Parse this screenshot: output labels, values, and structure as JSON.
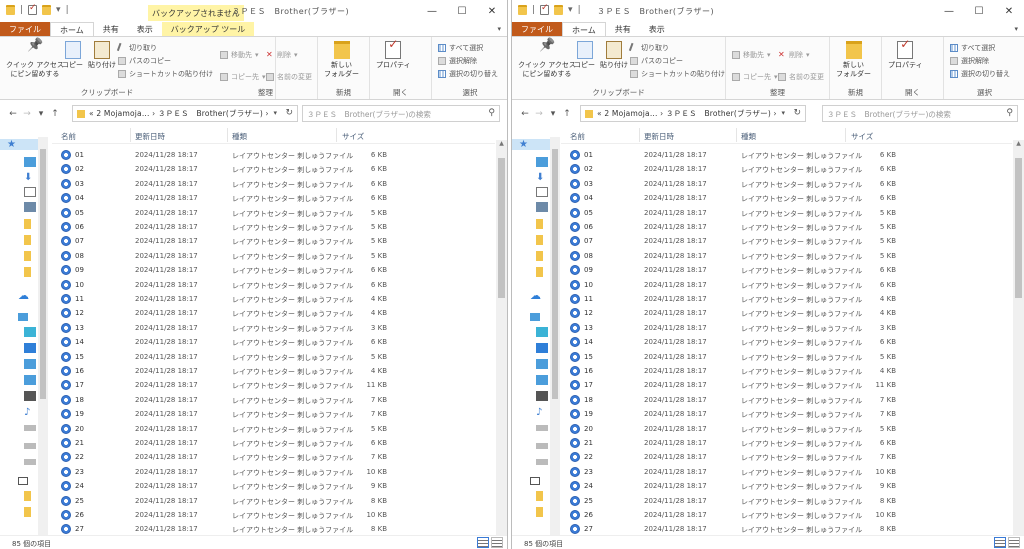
{
  "left": {
    "title": "３ＰＥＳ　Brother(ブラザー)",
    "context_tab_title": "バックアップされません",
    "status": "85 個の項目"
  },
  "right": {
    "title": "３ＰＥＳ　Brother(ブラザー)",
    "status": "85 個の項目"
  },
  "tabs": {
    "file": "ファイル",
    "home": "ホーム",
    "share": "共有",
    "view": "表示",
    "backup_tool": "バックアップ ツール"
  },
  "ribbon": {
    "pin": "クイック アクセス\nにピン留めする",
    "copy": "コピー",
    "paste": "貼り付け",
    "cut": "切り取り",
    "copy_path": "パスのコピー",
    "paste_shortcut": "ショートカットの貼り付け",
    "clipboard": "クリップボード",
    "move_to": "移動先",
    "copy_to": "コピー先",
    "delete": "削除",
    "rename": "名前の変更",
    "organize": "整理",
    "new_folder": "新しい\nフォルダー",
    "new": "新規",
    "properties": "プロパティ",
    "open": "開く",
    "select_all": "すべて選択",
    "select_none": "選択解除",
    "invert_selection": "選択の切り替え",
    "select": "選択"
  },
  "address": {
    "path": "«  2 Mojamoja...  ›  ３ＰＥＳ　Brother(ブラザー)  ›",
    "search_placeholder": "３ＰＥＳ　Brother(ブラザー)の検索"
  },
  "columns": {
    "name": "名前",
    "date": "更新日時",
    "type": "種類",
    "size": "サイズ"
  },
  "files": [
    {
      "name": "01",
      "date": "2024/11/28 18:17",
      "type": "レイアウトセンター 刺しゅうファイル",
      "size": "6 KB"
    },
    {
      "name": "02",
      "date": "2024/11/28 18:17",
      "type": "レイアウトセンター 刺しゅうファイル",
      "size": "6 KB"
    },
    {
      "name": "03",
      "date": "2024/11/28 18:17",
      "type": "レイアウトセンター 刺しゅうファイル",
      "size": "6 KB"
    },
    {
      "name": "04",
      "date": "2024/11/28 18:17",
      "type": "レイアウトセンター 刺しゅうファイル",
      "size": "6 KB"
    },
    {
      "name": "05",
      "date": "2024/11/28 18:17",
      "type": "レイアウトセンター 刺しゅうファイル",
      "size": "5 KB"
    },
    {
      "name": "06",
      "date": "2024/11/28 18:17",
      "type": "レイアウトセンター 刺しゅうファイル",
      "size": "5 KB"
    },
    {
      "name": "07",
      "date": "2024/11/28 18:17",
      "type": "レイアウトセンター 刺しゅうファイル",
      "size": "5 KB"
    },
    {
      "name": "08",
      "date": "2024/11/28 18:17",
      "type": "レイアウトセンター 刺しゅうファイル",
      "size": "5 KB"
    },
    {
      "name": "09",
      "date": "2024/11/28 18:17",
      "type": "レイアウトセンター 刺しゅうファイル",
      "size": "6 KB"
    },
    {
      "name": "10",
      "date": "2024/11/28 18:17",
      "type": "レイアウトセンター 刺しゅうファイル",
      "size": "6 KB"
    },
    {
      "name": "11",
      "date": "2024/11/28 18:17",
      "type": "レイアウトセンター 刺しゅうファイル",
      "size": "4 KB"
    },
    {
      "name": "12",
      "date": "2024/11/28 18:17",
      "type": "レイアウトセンター 刺しゅうファイル",
      "size": "4 KB"
    },
    {
      "name": "13",
      "date": "2024/11/28 18:17",
      "type": "レイアウトセンター 刺しゅうファイル",
      "size": "3 KB"
    },
    {
      "name": "14",
      "date": "2024/11/28 18:17",
      "type": "レイアウトセンター 刺しゅうファイル",
      "size": "6 KB"
    },
    {
      "name": "15",
      "date": "2024/11/28 18:17",
      "type": "レイアウトセンター 刺しゅうファイル",
      "size": "5 KB"
    },
    {
      "name": "16",
      "date": "2024/11/28 18:17",
      "type": "レイアウトセンター 刺しゅうファイル",
      "size": "4 KB"
    },
    {
      "name": "17",
      "date": "2024/11/28 18:17",
      "type": "レイアウトセンター 刺しゅうファイル",
      "size": "11 KB"
    },
    {
      "name": "18",
      "date": "2024/11/28 18:17",
      "type": "レイアウトセンター 刺しゅうファイル",
      "size": "7 KB"
    },
    {
      "name": "19",
      "date": "2024/11/28 18:17",
      "type": "レイアウトセンター 刺しゅうファイル",
      "size": "7 KB"
    },
    {
      "name": "20",
      "date": "2024/11/28 18:17",
      "type": "レイアウトセンター 刺しゅうファイル",
      "size": "5 KB"
    },
    {
      "name": "21",
      "date": "2024/11/28 18:17",
      "type": "レイアウトセンター 刺しゅうファイル",
      "size": "6 KB"
    },
    {
      "name": "22",
      "date": "2024/11/28 18:17",
      "type": "レイアウトセンター 刺しゅうファイル",
      "size": "7 KB"
    },
    {
      "name": "23",
      "date": "2024/11/28 18:17",
      "type": "レイアウトセンター 刺しゅうファイル",
      "size": "10 KB"
    },
    {
      "name": "24",
      "date": "2024/11/28 18:17",
      "type": "レイアウトセンター 刺しゅうファイル",
      "size": "9 KB"
    },
    {
      "name": "25",
      "date": "2024/11/28 18:17",
      "type": "レイアウトセンター 刺しゅうファイル",
      "size": "8 KB"
    },
    {
      "name": "26",
      "date": "2024/11/28 18:17",
      "type": "レイアウトセンター 刺しゅうファイル",
      "size": "10 KB"
    },
    {
      "name": "27",
      "date": "2024/11/28 18:17",
      "type": "レイアウトセンター 刺しゅうファイル",
      "size": "8 KB"
    }
  ],
  "icons": {
    "minimize": "minimize-icon",
    "maximize": "maximize-icon",
    "close": "close-icon",
    "file": "embroidery-file-icon",
    "folder": "folder-icon"
  },
  "colors": {
    "file_tab": "#c15a1b",
    "context_tab": "#fff4a6",
    "selection": "#cce4f7",
    "accent": "#3b7bd6"
  }
}
